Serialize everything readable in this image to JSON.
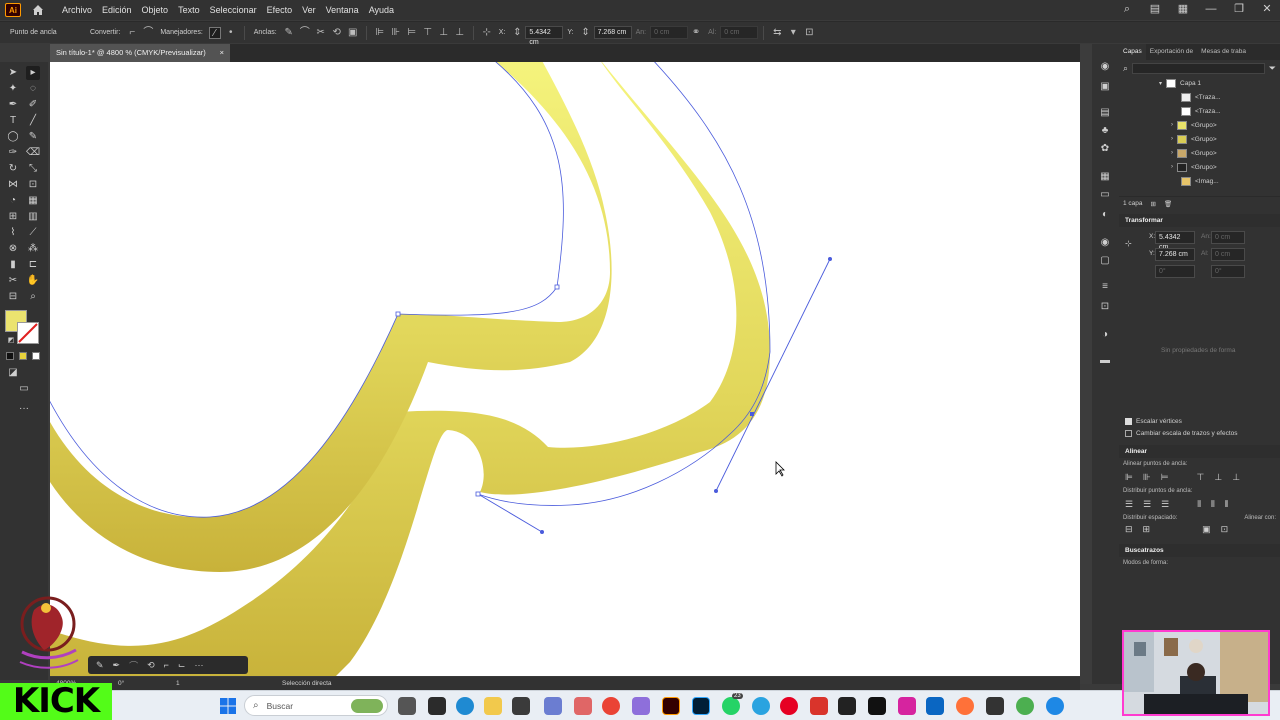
{
  "app": {
    "logo_text": "Ai",
    "menu": [
      "Archivo",
      "Edición",
      "Objeto",
      "Texto",
      "Seleccionar",
      "Efecto",
      "Ver",
      "Ventana",
      "Ayuda"
    ]
  },
  "controlbar": {
    "mode_label": "Punto de ancla",
    "convert_label": "Convertir:",
    "handles_label": "Manejadores:",
    "anchors_label": "Anclas:",
    "x_label": "X:",
    "x_value": "5.4342 cm",
    "y_label": "Y:",
    "y_value": "7.268 cm",
    "w_label": "An:",
    "w_value": "0 cm",
    "h_label": "Al:",
    "h_value": "0 cm"
  },
  "document": {
    "tab_title": "Sin título-1* @ 4800 % (CMYK/Previsualizar)",
    "tab_close": "×"
  },
  "layers_panel": {
    "tabs": [
      "Capas",
      "Exportación de",
      "Mesas de traba"
    ],
    "layer_name": "Capa 1",
    "rows": [
      "<Traza...",
      "<Traza...",
      "<Grupo>",
      "<Grupo>",
      "<Grupo>",
      "<Grupo>",
      "<Imag..."
    ],
    "footer_count": "1 capa"
  },
  "transform_panel": {
    "title": "Transformar",
    "x_label": "X:",
    "x_value": "5.4342 cm",
    "y_label": "Y:",
    "y_value": "7.268 cm",
    "w_label": "An:",
    "w_value": "0 cm",
    "h_label": "Al:",
    "h_value": "0 cm",
    "angle_value": "0°",
    "shear_value": "0°",
    "no_props": "Sin propiedades de forma",
    "scale_corners": "Escalar vértices",
    "scale_strokes": "Cambiar escala de trazos y efectos"
  },
  "align_panel": {
    "title": "Alinear",
    "align_anchors": "Alinear puntos de ancla:",
    "distribute_anchors": "Distribuir puntos de ancla:",
    "distribute_spacing": "Distribuir espaciado:",
    "align_to": "Alinear con:"
  },
  "pathfinder_panel": {
    "title": "Buscatrazos",
    "shape_modes": "Modos de forma:"
  },
  "status": {
    "zoom": "4800%",
    "rotation": "0°",
    "artboard": "1",
    "tool_name": "Selección directa"
  },
  "taskbar": {
    "search_placeholder": "Buscar",
    "badge": "23"
  },
  "overlay": {
    "kick_text": "KICK"
  },
  "colors": {
    "fill_yellow": "#e8e26a",
    "path_blue": "#4a5bdc",
    "kick_green": "#53fc18",
    "webcam_border": "#ff3bd0"
  }
}
